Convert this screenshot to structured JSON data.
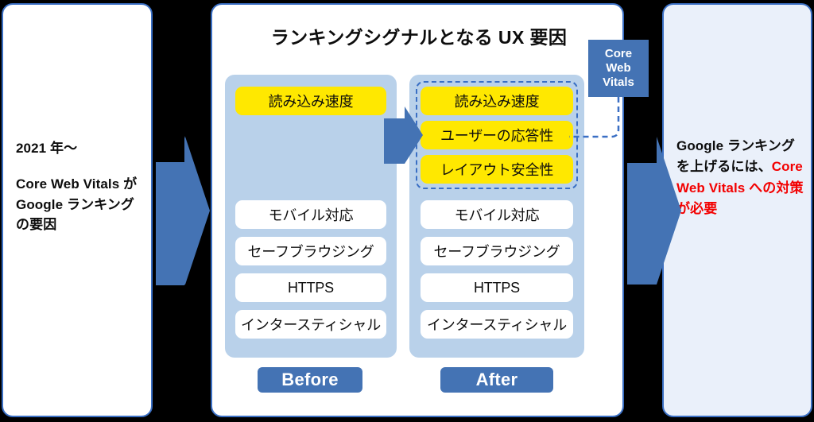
{
  "colors": {
    "arrow_blue": "#4473B4",
    "panel_border": "#3A6FC4",
    "column_bg": "#B9D1EA",
    "highlight_yellow": "#FFE800",
    "accent_red": "#F30000",
    "right_panel_bg": "#EAF0FA",
    "badge_blue": "#4473B4"
  },
  "left_panel": {
    "line1": "2021 年〜",
    "line2": "Core Web Vitals が Google ランキングの要因"
  },
  "center_panel": {
    "title": "ランキングシグナルとなる UX 要因",
    "before": {
      "label": "Before",
      "highlighted_items": [
        "読み込み速度"
      ],
      "items": [
        "モバイル対応",
        "セーフブラウジング",
        "HTTPS",
        "インタースティシャル"
      ]
    },
    "after": {
      "label": "After",
      "highlighted_items": [
        "読み込み速度",
        "ユーザーの応答性",
        "レイアウト安全性"
      ],
      "items": [
        "モバイル対応",
        "セーフブラウジング",
        "HTTPS",
        "インタースティシャル"
      ]
    }
  },
  "badge": {
    "line1": "Core",
    "line2": "Web",
    "line3": "Vitals"
  },
  "right_panel": {
    "text_plain": "Google ランキングを上げるには、",
    "text_accent": "Core Web Vitals への対策が必要"
  },
  "icons": {
    "arrow_left_to_center": "right-arrow-icon",
    "arrow_before_to_after": "right-arrow-icon",
    "arrow_center_to_right": "right-arrow-icon",
    "badge_connector": "dashed-connector-icon"
  }
}
